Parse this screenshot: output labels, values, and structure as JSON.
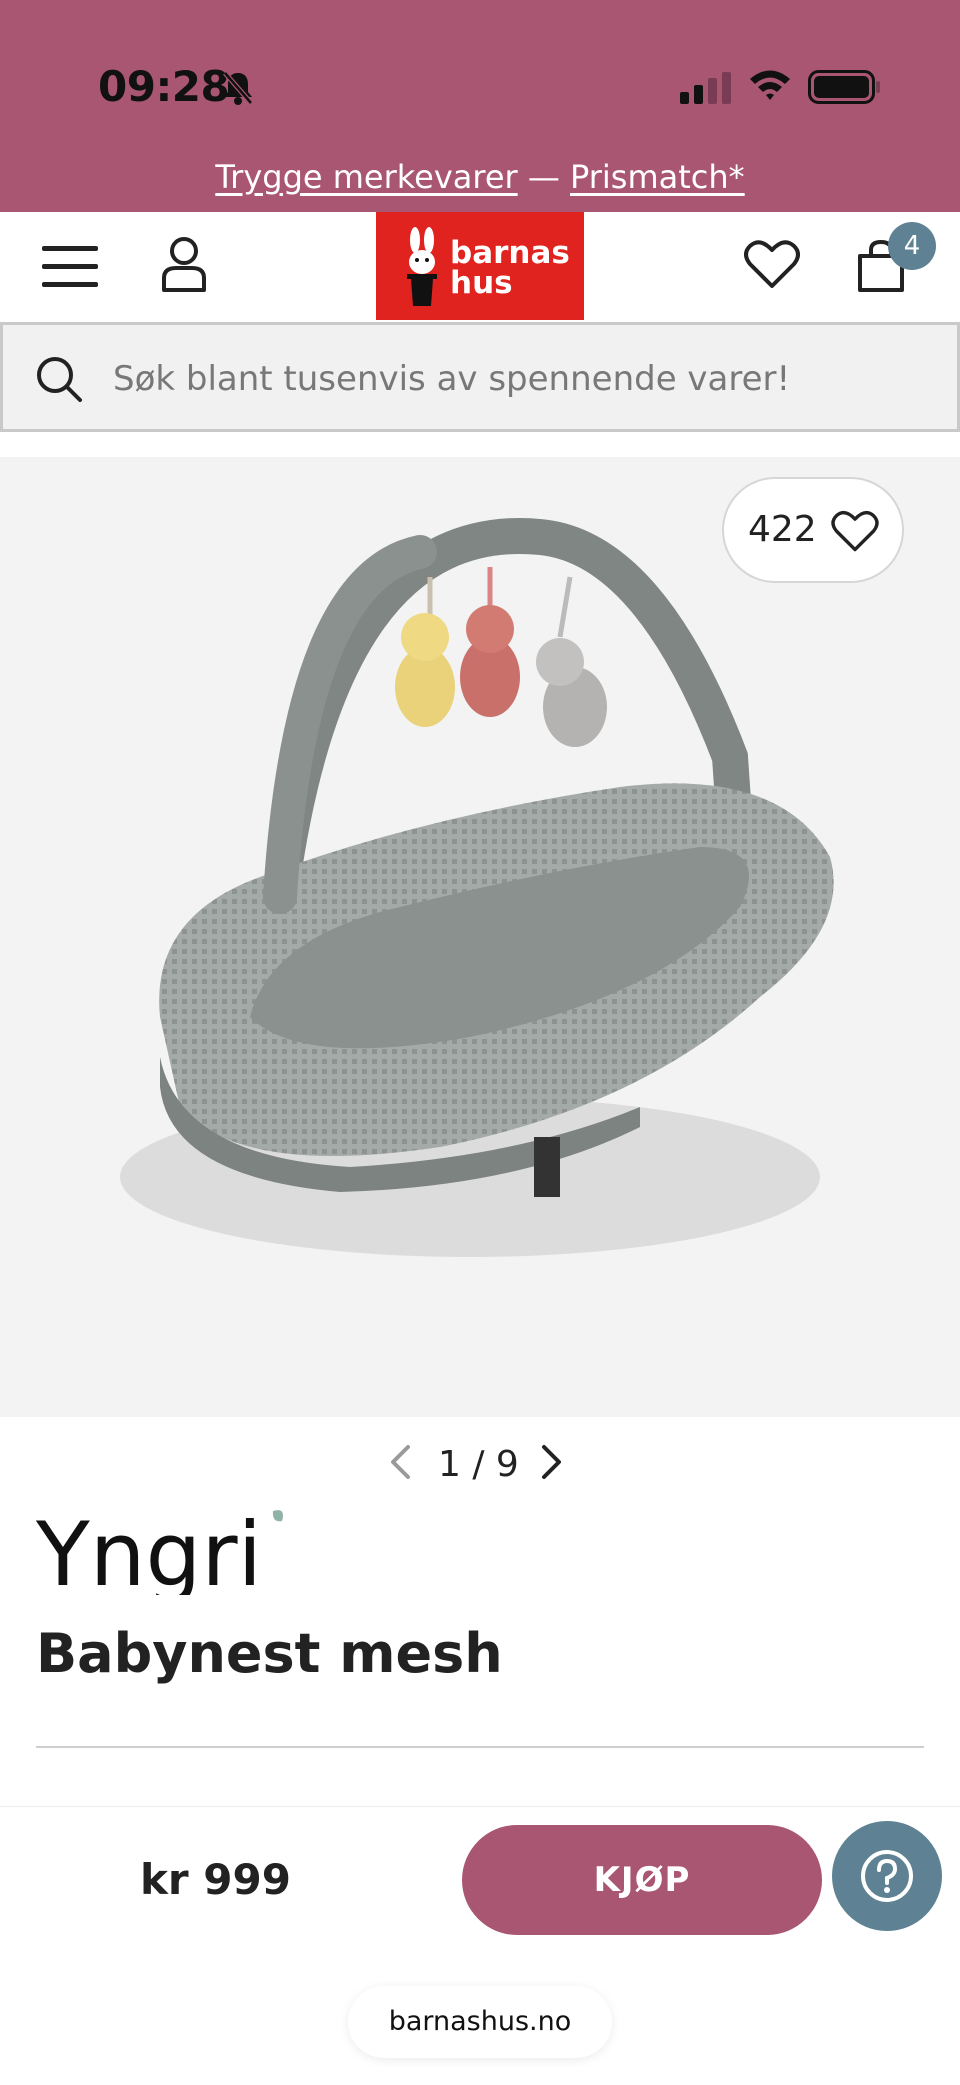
{
  "status_bar": {
    "time": "09:28",
    "icons": [
      "bell-slash-icon",
      "cellular-signal-icon",
      "wifi-icon",
      "battery-icon"
    ]
  },
  "promo": {
    "link1": "Trygge merkevarer",
    "separator": " — ",
    "link2": "Prismatch*"
  },
  "header": {
    "logo_line1": "barnas",
    "logo_line2": "hus",
    "cart_count": "4",
    "icons": [
      "menu-icon",
      "account-icon",
      "heart-icon",
      "cart-icon"
    ]
  },
  "search": {
    "placeholder": "Søk blant tusenvis av spennende varer!"
  },
  "gallery": {
    "favorites_count": "422",
    "pager_text": "1 / 9",
    "current_image": 1,
    "total_images": 9
  },
  "product": {
    "brand": "Yngri",
    "title": "Babynest mesh"
  },
  "buybar": {
    "price": "kr 999",
    "buy_label": "KJØP"
  },
  "browser": {
    "url": "barnashus.no"
  },
  "colors": {
    "brand_pink": "#a95673",
    "logo_red": "#e0231e",
    "accent_blue": "#5e8293"
  }
}
